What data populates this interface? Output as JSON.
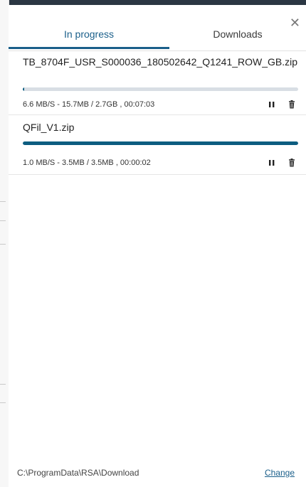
{
  "tabs": {
    "in_progress": "In progress",
    "downloads": "Downloads"
  },
  "downloads": [
    {
      "name": "TB_8704F_USR_S000036_180502642_Q1241_ROW_GB.zip",
      "progress_percent": 0.6,
      "status": "6.6 MB/S - 15.7MB / 2.7GB , 00:07:03"
    },
    {
      "name": "QFil_V1.zip",
      "progress_percent": 100,
      "status": "1.0 MB/S - 3.5MB / 3.5MB , 00:00:02"
    }
  ],
  "footer": {
    "path": "C:\\ProgramData\\RSA\\Download",
    "change_label": "Change"
  },
  "icons": {
    "close": "close-icon",
    "pause": "pause-icon",
    "delete": "trash-icon"
  },
  "colors": {
    "accent": "#1a5f8a",
    "progress_fill": "#0d5d80",
    "track": "#d8dee4"
  }
}
